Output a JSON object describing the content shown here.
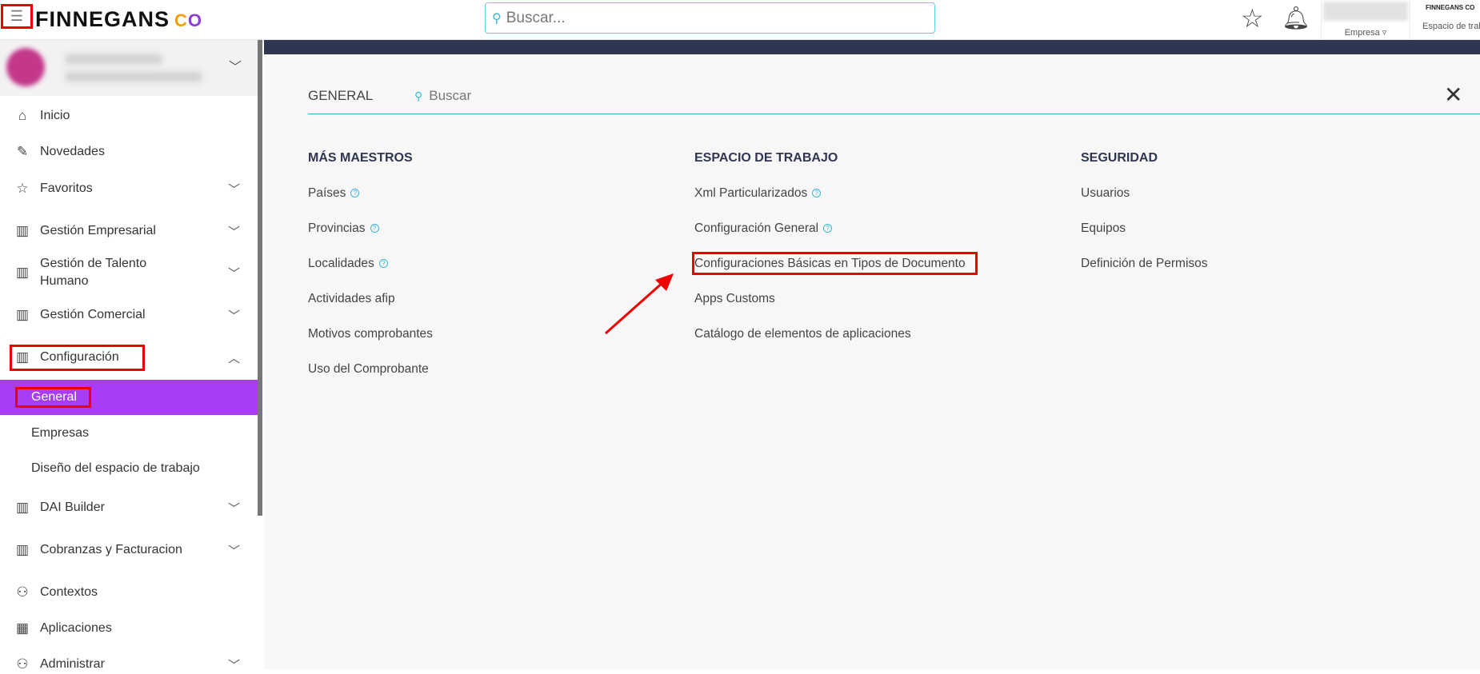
{
  "header": {
    "brand": "FINNEGANS",
    "brand_mark_a": "C",
    "brand_mark_b": "O",
    "search_placeholder": "Buscar...",
    "company_label": "Empresa ▿",
    "workspace_label": "Espacio de trabajo",
    "workspace_mini_logo": "FINNEGANS CO"
  },
  "sidebar": {
    "items": [
      {
        "label": "Inicio",
        "icon": "⌂"
      },
      {
        "label": "Novedades",
        "icon": "✎"
      },
      {
        "label": "Favoritos",
        "icon": "☆"
      },
      {
        "label": "Gestión Empresarial",
        "icon": "▥"
      },
      {
        "label": "Gestión de Talento Humano",
        "icon": "▥"
      },
      {
        "label": "Gestión Comercial",
        "icon": "▥"
      },
      {
        "label": "Configuración",
        "icon": "▥"
      },
      {
        "label": "DAI Builder",
        "icon": "▥"
      },
      {
        "label": "Cobranzas y Facturacion",
        "icon": "▥"
      },
      {
        "label": "Contextos",
        "icon": "⚇"
      },
      {
        "label": "Aplicaciones",
        "icon": "▦"
      },
      {
        "label": "Administrar",
        "icon": "⚇"
      }
    ],
    "config_sub": [
      "General",
      "Empresas",
      "Diseño del espacio de trabajo"
    ]
  },
  "panel": {
    "title": "GENERAL",
    "search_placeholder": "Buscar",
    "columns": [
      {
        "heading": "MÁS MAESTROS",
        "items": [
          {
            "label": "Países",
            "help": true
          },
          {
            "label": "Provincias",
            "help": true
          },
          {
            "label": "Localidades",
            "help": true
          },
          {
            "label": "Actividades afip"
          },
          {
            "label": "Motivos comprobantes"
          },
          {
            "label": "Uso del Comprobante"
          }
        ]
      },
      {
        "heading": "ESPACIO DE TRABAJO",
        "items": [
          {
            "label": "Xml Particularizados",
            "help": true
          },
          {
            "label": "Configuración General",
            "help": true
          },
          {
            "label": "Configuraciones Básicas en Tipos de Documento"
          },
          {
            "label": "Apps Customs"
          },
          {
            "label": "Catálogo de elementos de aplicaciones"
          }
        ]
      },
      {
        "heading": "SEGURIDAD",
        "items": [
          {
            "label": "Usuarios"
          },
          {
            "label": "Equipos"
          },
          {
            "label": "Definición de Permisos"
          }
        ]
      }
    ]
  },
  "colors": {
    "accent": "#a93cf7",
    "highlight": "#ee0000",
    "band": "#2f3650",
    "cyan": "#3bb7d4"
  }
}
